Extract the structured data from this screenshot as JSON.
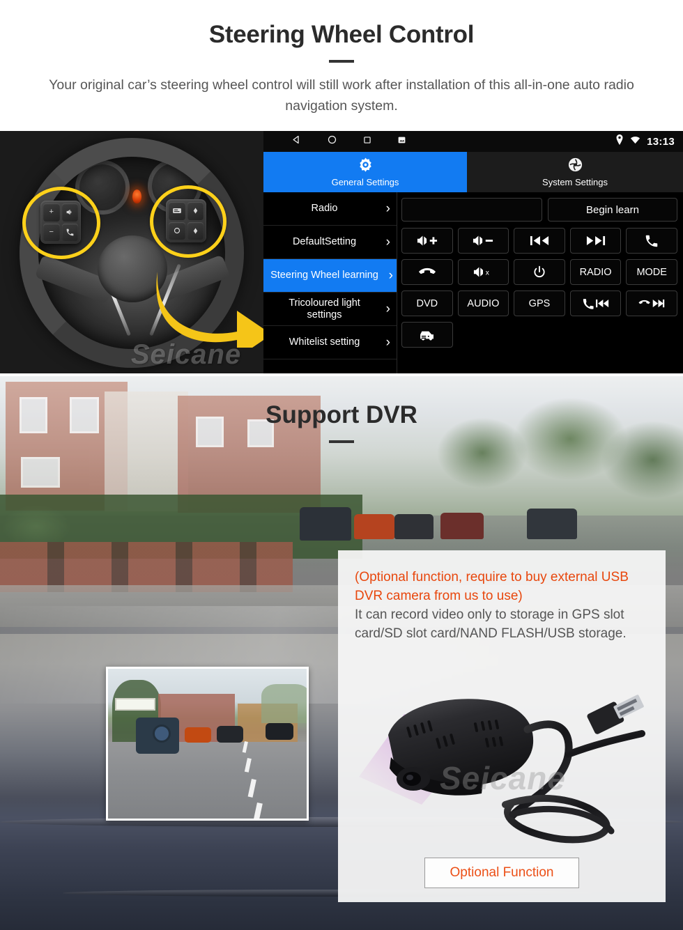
{
  "section_swc": {
    "title": "Steering Wheel Control",
    "subtitle": "Your original car’s steering wheel control will still work after installation of this all-in-one auto radio navigation system."
  },
  "android": {
    "statusbar": {
      "back_icon": "back-triangle-icon",
      "home_icon": "home-circle-icon",
      "recents_icon": "recents-square-icon",
      "screenshot_icon": "screenshot-icon",
      "location_icon": "location-pin-icon",
      "wifi_icon": "wifi-icon",
      "clock": "13:13"
    },
    "tabs": [
      {
        "label": "General Settings",
        "icon": "settings-gear-icon",
        "active": true
      },
      {
        "label": "System Settings",
        "icon": "system-settings-icon",
        "active": false
      }
    ],
    "menu": [
      {
        "label": "Radio",
        "active": false
      },
      {
        "label": "DefaultSetting",
        "active": false
      },
      {
        "label": "Steering Wheel learning",
        "active": true
      },
      {
        "label": "Tricoloured light settings",
        "active": false
      },
      {
        "label": "Whitelist setting",
        "active": false
      }
    ],
    "learn_input_value": "",
    "learn_input_placeholder": "",
    "begin_learn_label": "Begin learn",
    "keys": [
      {
        "name": "volume-up-button",
        "icon": "volume-up-icon",
        "label": ""
      },
      {
        "name": "volume-down-button",
        "icon": "volume-down-icon",
        "label": ""
      },
      {
        "name": "previous-track-button",
        "icon": "previous-icon",
        "label": ""
      },
      {
        "name": "next-track-button",
        "icon": "next-icon",
        "label": ""
      },
      {
        "name": "answer-call-button",
        "icon": "phone-icon",
        "label": ""
      },
      {
        "name": "hangup-call-button",
        "icon": "hangup-icon",
        "label": ""
      },
      {
        "name": "mute-button",
        "icon": "volume-mute-icon",
        "label": ""
      },
      {
        "name": "power-button",
        "icon": "power-icon",
        "label": ""
      },
      {
        "name": "radio-button",
        "icon": "",
        "label": "RADIO"
      },
      {
        "name": "mode-button",
        "icon": "",
        "label": "MODE"
      },
      {
        "name": "dvd-button",
        "icon": "",
        "label": "DVD"
      },
      {
        "name": "audio-button",
        "icon": "",
        "label": "AUDIO"
      },
      {
        "name": "gps-button",
        "icon": "",
        "label": "GPS"
      },
      {
        "name": "phone-previous-button",
        "icon": "phone-previous-icon",
        "label": ""
      },
      {
        "name": "hangup-next-button",
        "icon": "hangup-next-icon",
        "label": ""
      },
      {
        "name": "car-info-button",
        "icon": "car-icon",
        "label": ""
      }
    ],
    "colors": {
      "accent_blue": "#127bf2",
      "panel_black": "#000000"
    }
  },
  "wheel_photo": {
    "watermark": "Seicane",
    "left_pod_keys": [
      "+",
      "−",
      "voice-icon",
      "phone-icon"
    ],
    "right_pod_keys": [
      "list-icon",
      "up-icon",
      "circle-icon",
      "down-icon"
    ],
    "highlight_color": "#ffd11a",
    "arrow_color": "#f5c518"
  },
  "section_dvr": {
    "title": "Support DVR",
    "info_accent": "(Optional function, require to buy external USB DVR camera from us to use)",
    "info_body": "It can record video only to storage in GPS slot card/SD slot card/NAND FLASH/USB storage.",
    "accent_color": "#e8470d",
    "optional_button_label": "Optional Function",
    "camera_watermark": "Seicane"
  }
}
